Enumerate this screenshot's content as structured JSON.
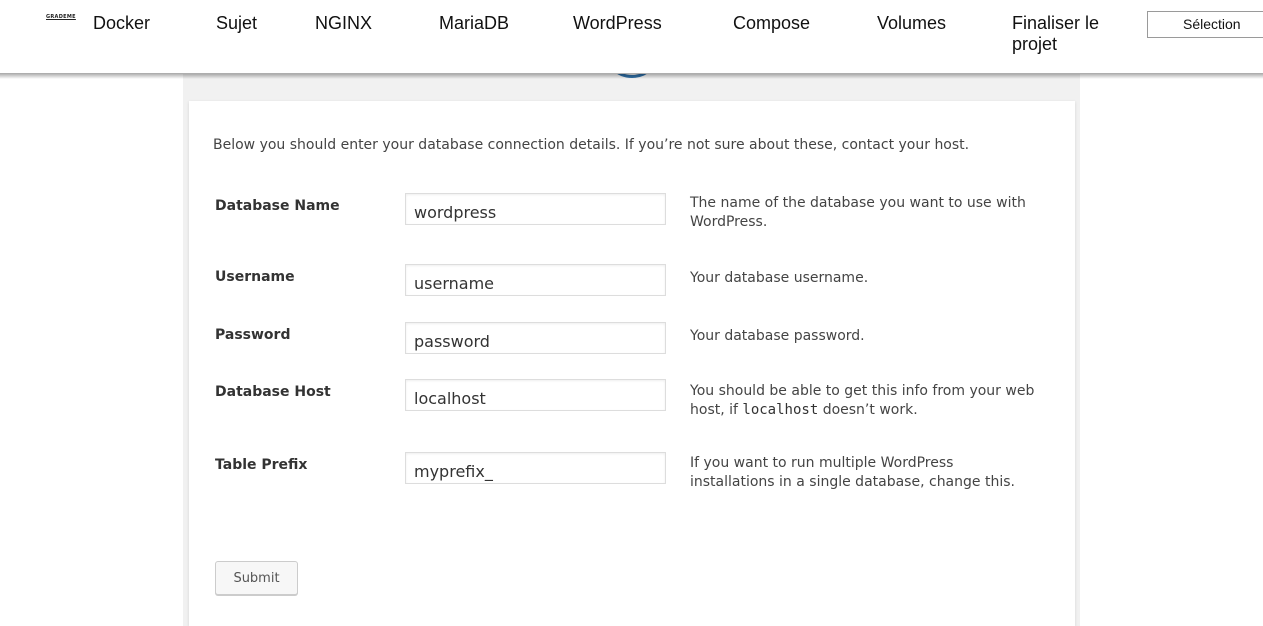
{
  "nav": {
    "logo_text": "GRADEME",
    "links": [
      "Docker",
      "Sujet",
      "NGINX",
      "MariaDB",
      "WordPress",
      "Compose",
      "Volumes",
      "Finaliser le projet"
    ],
    "select_value": "Sélection"
  },
  "form": {
    "intro": "Below you should enter your database connection details. If you’re not sure about these, contact your host.",
    "fields": [
      {
        "label": "Database Name",
        "value": "wordpress",
        "help": "The name of the database you want to use with WordPress."
      },
      {
        "label": "Username",
        "value": "username",
        "help": "Your database username."
      },
      {
        "label": "Password",
        "value": "password",
        "help": "Your database password."
      },
      {
        "label": "Database Host",
        "value": "localhost",
        "help_pre": "You should be able to get this info from your web host, if ",
        "help_code": "localhost",
        "help_post": " doesn’t work."
      },
      {
        "label": "Table Prefix",
        "value": "myprefix_",
        "help": "If you want to run multiple WordPress installations in a single database, change this."
      }
    ],
    "submit_label": "Submit"
  },
  "colors": {
    "accent_circle": "#2e6da4",
    "page_background": "#f1f1f1"
  }
}
